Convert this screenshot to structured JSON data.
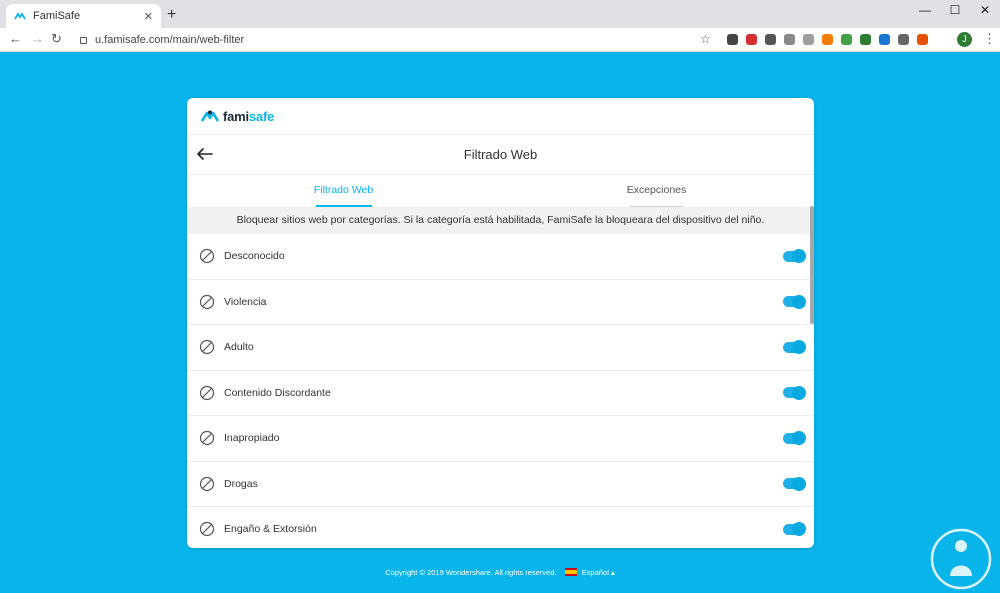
{
  "browser": {
    "tab_title": "FamiSafe",
    "tab_close": "✕",
    "new_tab": "+",
    "url": "u.famisafe.com/main/web-filter",
    "back": "←",
    "forward": "→",
    "reload": "↻",
    "star": "☆",
    "minimize": "—",
    "maximize": "☐",
    "close": "✕",
    "profile_initial": "J",
    "menu": "⋮",
    "extension_colors": [
      "#444444",
      "#d32f2f",
      "#555555",
      "#888888",
      "#9e9e9e",
      "#f57c00",
      "#43a047",
      "#2e7d32",
      "#1976d2",
      "#666666",
      "#e65100"
    ]
  },
  "app": {
    "brand_prefix": "fami",
    "brand_suffix": "safe",
    "page_title": "Filtrado Web",
    "tabs": [
      {
        "label": "Filtrado Web",
        "active": true
      },
      {
        "label": "Excepciones",
        "active": false
      }
    ],
    "info_text": "Bloquear sitios web por categorías. Si la categoría está habilitada, FamiSafe la bloqueara del dispositivo del niño.",
    "categories": [
      {
        "label": "Desconocido",
        "enabled": true
      },
      {
        "label": "Violencia",
        "enabled": true
      },
      {
        "label": "Adulto",
        "enabled": true
      },
      {
        "label": "Contenido Discordante",
        "enabled": true
      },
      {
        "label": "Inapropiado",
        "enabled": true
      },
      {
        "label": "Drogas",
        "enabled": true
      },
      {
        "label": "Engaño & Extorsión",
        "enabled": true
      }
    ]
  },
  "footer": {
    "copyright": "Copyright © 2019 Wondershare. All rights reserved.",
    "language": "Español",
    "caret": "▴"
  },
  "colors": {
    "accent": "#08b4ea",
    "background": "#08b4ea"
  }
}
